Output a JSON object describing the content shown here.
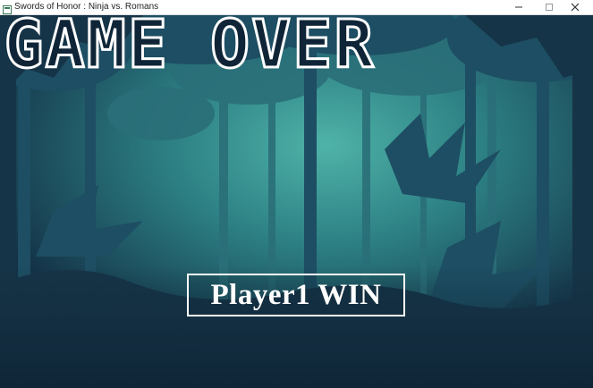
{
  "window": {
    "title": "Swords of Honor : Ninja vs. Romans",
    "icon": "app-window-icon",
    "controls": [
      "minimize-icon",
      "maximize-icon",
      "close-icon"
    ]
  },
  "game": {
    "headline": "GAME OVER",
    "result": "Player1 WIN"
  },
  "colors": {
    "sky_teal": "#2f8f8c",
    "foliage_dark": "#163447",
    "foliage_mid": "#1d4e63",
    "text": "#ffffff",
    "titlebar": "#ffffff"
  }
}
